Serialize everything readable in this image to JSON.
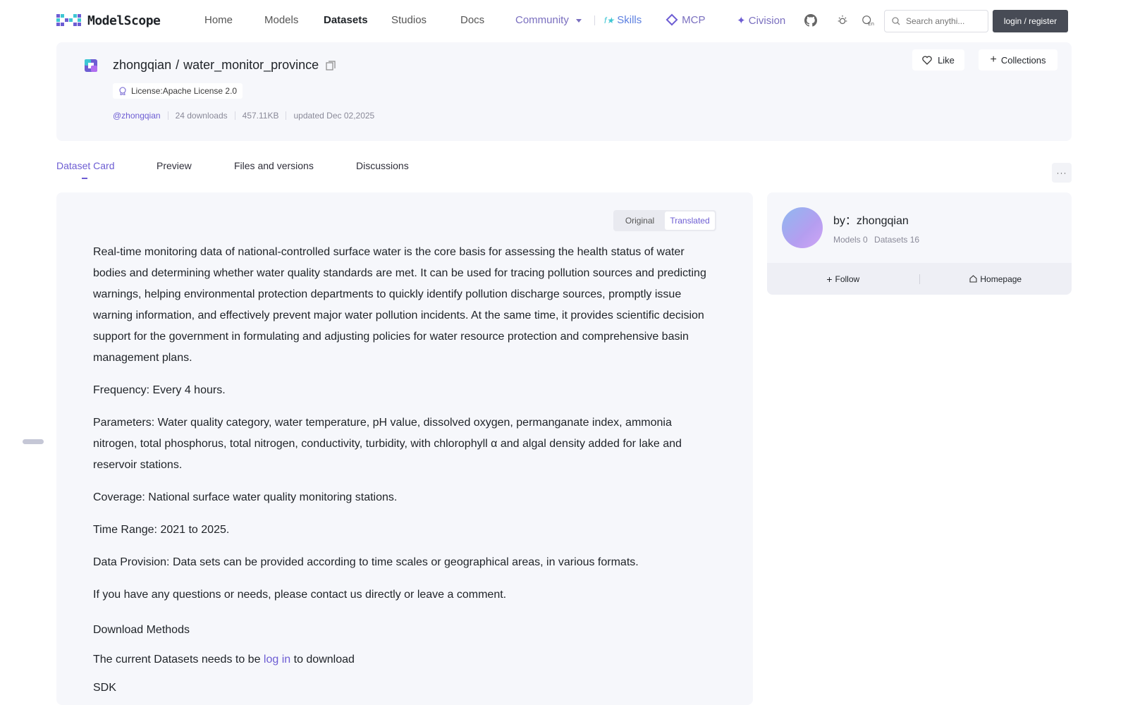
{
  "brand": {
    "name": "ModelScope"
  },
  "nav": {
    "home": "Home",
    "models": "Models",
    "datasets": "Datasets",
    "studios": "Studios",
    "docs": "Docs",
    "community": "Community",
    "skills": "Skills",
    "mcp": "MCP",
    "civision": "Civision"
  },
  "search": {
    "placeholder": "Search anythi..."
  },
  "login": "login / register",
  "dataset": {
    "owner": "zhongqian",
    "slash": "/",
    "name": "water_monitor_province",
    "license": "License:Apache License 2.0",
    "user": "@zhongqian",
    "downloads": "24 downloads",
    "size": "457.11KB",
    "updated": "updated Dec 02,2025"
  },
  "actions": {
    "like": "Like",
    "collections": "Collections"
  },
  "tabs": [
    "Dataset Card",
    "Preview",
    "Files and versions",
    "Discussions"
  ],
  "more": "···",
  "toggle": {
    "original": "Original",
    "translated": "Translated"
  },
  "content": {
    "p1": "Real-time monitoring data of national-controlled surface water is the core basis for assessing the health status of water bodies and determining whether water quality standards are met. It can be used for tracing pollution sources and predicting warnings, helping environmental protection departments to quickly identify pollution discharge sources, promptly issue warning information, and effectively prevent major water pollution incidents. At the same time, it provides scientific decision support for the government in formulating and adjusting policies for water resource protection and comprehensive basin management plans.",
    "p2": "Frequency: Every 4 hours.",
    "p3": "Parameters: Water quality category, water temperature, pH value, dissolved oxygen, permanganate index, ammonia nitrogen, total phosphorus, total nitrogen, conductivity, turbidity, with chlorophyll α and algal density added for lake and reservoir stations.",
    "p4": "Coverage: National surface water quality monitoring stations.",
    "p5": "Time Range: 2021 to 2025.",
    "p6": "Data Provision: Data sets can be provided according to time scales or geographical areas, in various formats.",
    "p7": "If you have any questions or needs, please contact us directly or leave a comment.",
    "download_heading": "Download Methods",
    "download_pre": "The current Datasets needs to be ",
    "download_link": "log in",
    "download_post": " to download",
    "sdk": "SDK"
  },
  "author": {
    "by": "by：zhongqian",
    "models": "Models 0",
    "datasets": "Datasets 16",
    "follow": "Follow",
    "homepage": "Homepage"
  },
  "colors": {
    "accent": "#6d5dd3",
    "card_bg": "#f6f7fb",
    "login_bg": "#474b55"
  }
}
